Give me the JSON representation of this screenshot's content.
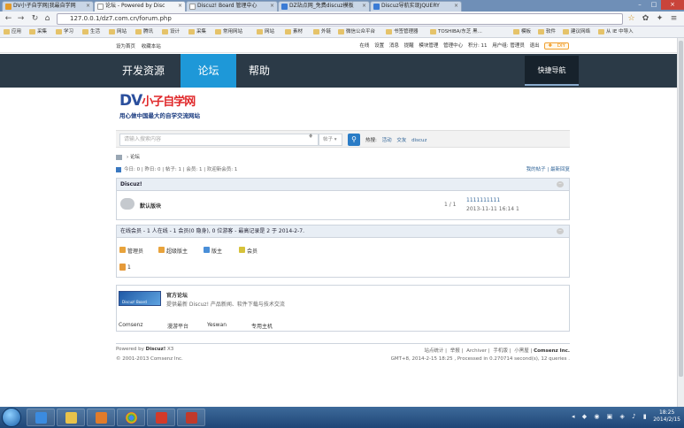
{
  "browser": {
    "tabs": [
      {
        "title": "DV小子自学网|我最自学网",
        "active": false
      },
      {
        "title": "论坛 - Powered by Disc",
        "active": true
      },
      {
        "title": "Discuz! Board 管理中心",
        "active": false
      },
      {
        "title": "DZ站点网_免费discuz模板",
        "active": false
      },
      {
        "title": "Discuz导航实现JQUERY",
        "active": false
      }
    ],
    "url": "127.0.0.1/dz7.com.cn/forum.php",
    "bookmarks": [
      "应用",
      "采集",
      "学习",
      "生活",
      "网站",
      "腾讯",
      "设计",
      "采集",
      "常用网站",
      "网站",
      "素材",
      "外链",
      "微信公众平台",
      "书签管理器",
      "TOSHIBA/东芝 黑...",
      "模板",
      "软件",
      "建议网络",
      "从 IE 中导入"
    ]
  },
  "site": {
    "topbar_left": [
      "设为首页",
      "收藏本站"
    ],
    "topbar_right": [
      "在线",
      "设置",
      "消息",
      "提醒",
      "模块管理",
      "管理中心",
      "积分: 11",
      "用户组: 管理员",
      "退出"
    ],
    "diy_label": "DIY",
    "nav": [
      "开发资源",
      "论坛",
      "帮助"
    ],
    "quick_nav": "快捷导航",
    "logo_main": "DV",
    "logo_sub": "小子自学网",
    "logo_slogan": "用心做中国最大的自学交流网站",
    "search_placeholder": "请输入搜索内容",
    "search_scope": "帖子",
    "hot_label": "热搜:",
    "hot_terms": [
      "活动",
      "交友",
      "discuz"
    ],
    "breadcrumb": "论坛",
    "stats": "今日: 0 | 昨日: 0 | 帖子: 1 | 会员: 1 | 欢迎新会员: 1",
    "my_posts": "我的帖子",
    "latest": "最新回复",
    "forum_group": "Discuz!",
    "forum": {
      "name": "默认版块",
      "count": "1 / 1",
      "last_title": "1111111111",
      "last_time": "2013-11-11 16:14 1"
    },
    "online_text": "在线会员 - 1 人在线 - 1 会员(0 隐身), 0 位游客 - 最高记录是 2 于 2014-2-7.",
    "online_legend": [
      {
        "label": "管理员",
        "color": "#e8a33c"
      },
      {
        "label": "超级版主",
        "color": "#e8a33c"
      },
      {
        "label": "版主",
        "color": "#4a8fd8"
      },
      {
        "label": "会员",
        "color": "#d6c23a"
      }
    ],
    "online_user": "1",
    "official_title": "官方论坛",
    "official_desc": "提供最新 Discuz! 产品新闻、软件下载与技术交流",
    "official_banner": "Discuz! Board",
    "links": [
      "Comsenz",
      "漫游平台",
      "Yeswan",
      "专用主机"
    ],
    "footer_powered": "Powered by",
    "footer_brand": "Discuz!",
    "footer_version": "X3",
    "footer_copy": "© 2001-2013 Comsenz Inc.",
    "footer_links": [
      "站点统计",
      "举报",
      "Archiver",
      "手机版",
      "小黑屋"
    ],
    "footer_company": "Comsenz Inc.",
    "footer_time": "GMT+8, 2014-2-15 18:25 , Processed in 0.270714 second(s), 12 queries ."
  },
  "taskbar": {
    "time": "18:25",
    "date": "2014/2/15"
  }
}
